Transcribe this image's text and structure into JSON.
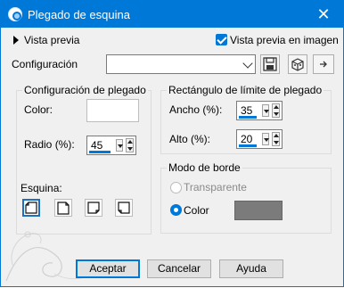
{
  "window": {
    "title": "Plegado de esquina",
    "close_glyph": "✕"
  },
  "top": {
    "preview_toggle": "Vista previa",
    "preview_in_image": "Vista previa en imagen",
    "config_label": "Configuración",
    "config_value": ""
  },
  "fold_config": {
    "title": "Configuración de plegado",
    "color_label": "Color:",
    "radius_label": "Radio (%):",
    "radius_value": "45",
    "corner_label": "Esquina:",
    "corners": [
      "top-left",
      "top-right",
      "bottom-right",
      "bottom-left"
    ],
    "selected_corner": "top-left",
    "color_value": "#ffffff"
  },
  "bounds": {
    "title": "Rectángulo de límite de plegado",
    "width_label": "Ancho (%):",
    "width_value": "35",
    "height_label": "Alto (%):",
    "height_value": "20"
  },
  "edge_mode": {
    "title": "Modo de borde",
    "option_transparent": "Transparente",
    "option_color": "Color",
    "selected": "Color",
    "color_value": "#7b7b7b"
  },
  "buttons": {
    "ok": "Aceptar",
    "cancel": "Cancelar",
    "help": "Ayuda"
  },
  "icons": {
    "app": "app-icon",
    "save": "save-icon",
    "reset": "reset-icon"
  },
  "colors": {
    "accent": "#0078d7",
    "dialog_bg": "#f0f0f0"
  }
}
